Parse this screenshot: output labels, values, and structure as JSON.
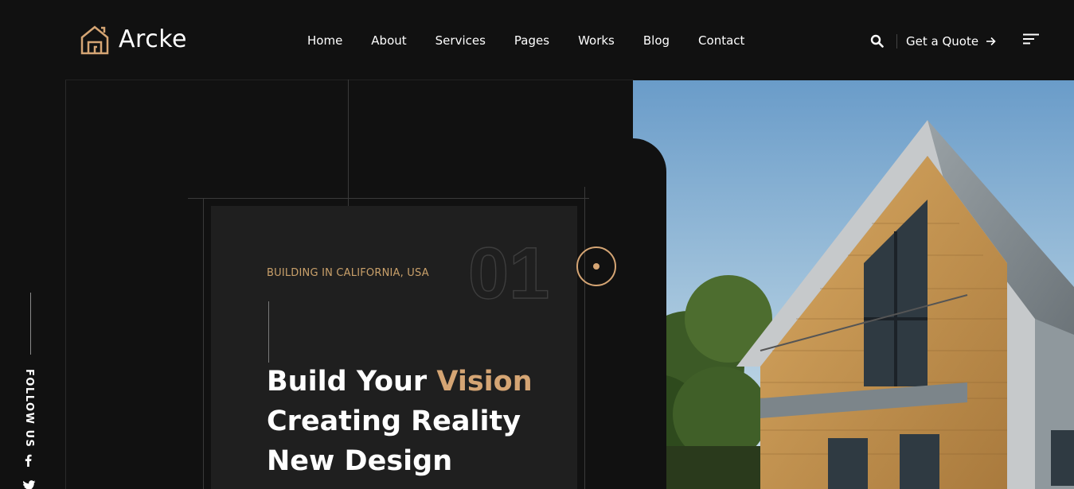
{
  "brand": {
    "name": "Arcke",
    "accent_color": "#d5a574"
  },
  "nav": {
    "items": [
      "Home",
      "About",
      "Services",
      "Pages",
      "Works",
      "Blog",
      "Contact"
    ]
  },
  "header": {
    "search_icon": "search-icon",
    "quote_label": "Get a Quote",
    "menu_icon": "hamburger-menu-icon"
  },
  "social": {
    "label": "FOLLOW US",
    "icons": [
      "facebook-icon",
      "twitter-icon"
    ]
  },
  "hero": {
    "kicker": "BUILDING IN CALIFORNIA, USA",
    "slide_number": "01",
    "headline_line1_pre": "Build Your ",
    "headline_line1_accent": "Vision",
    "headline_line2": "Creating Reality",
    "headline_line3": "New Design"
  }
}
